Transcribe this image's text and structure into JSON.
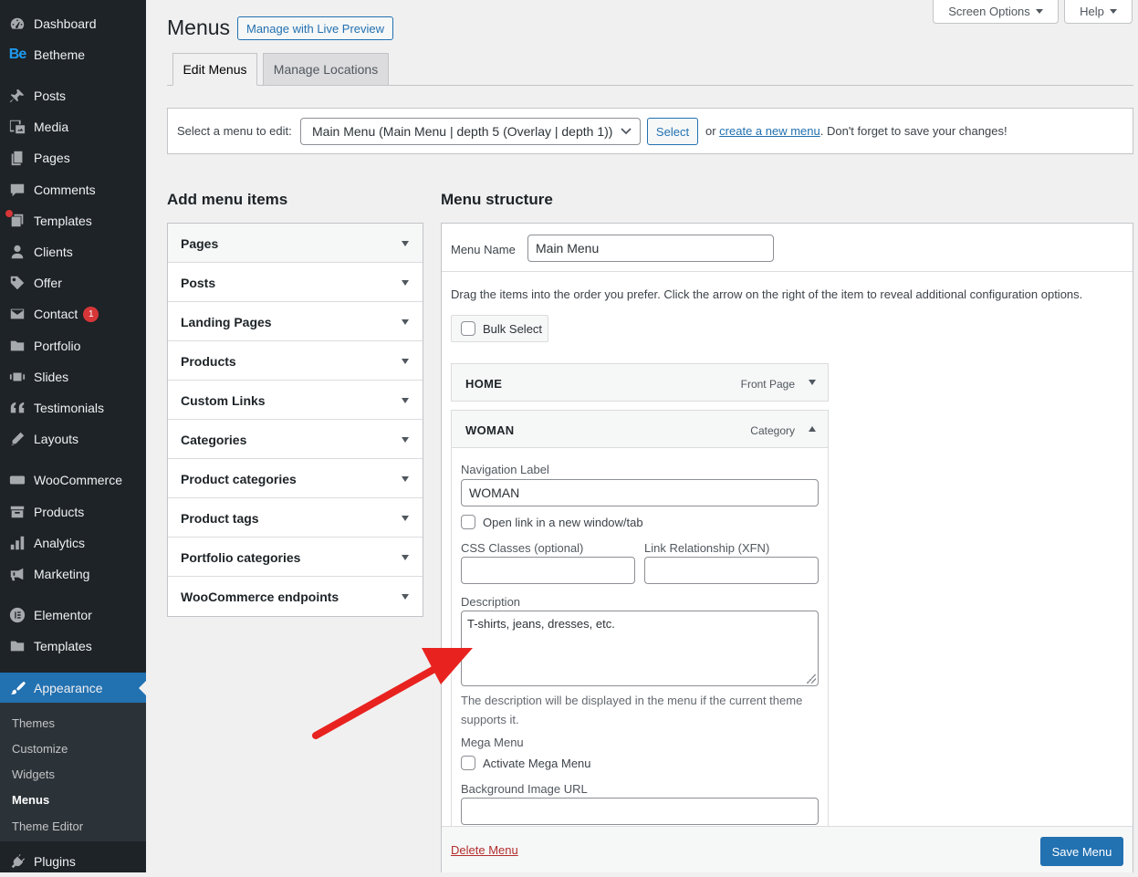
{
  "sidebar": {
    "items": [
      {
        "label": "Dashboard",
        "icon": "dashboard-icon"
      },
      {
        "label": "Betheme",
        "icon": "betheme-logo"
      },
      {
        "label": "Posts",
        "icon": "pushpin-icon"
      },
      {
        "label": "Media",
        "icon": "media-icon"
      },
      {
        "label": "Pages",
        "icon": "pages-icon"
      },
      {
        "label": "Comments",
        "icon": "comment-icon"
      },
      {
        "label": "Templates",
        "icon": "templates-icon"
      },
      {
        "label": "Clients",
        "icon": "person-icon"
      },
      {
        "label": "Offer",
        "icon": "tag-icon"
      },
      {
        "label": "Contact",
        "icon": "mail-icon",
        "badge": "1"
      },
      {
        "label": "Portfolio",
        "icon": "folder-icon"
      },
      {
        "label": "Slides",
        "icon": "slides-icon"
      },
      {
        "label": "Testimonials",
        "icon": "quote-icon"
      },
      {
        "label": "Layouts",
        "icon": "pencil-icon"
      },
      {
        "label": "WooCommerce",
        "icon": "woo-icon"
      },
      {
        "label": "Products",
        "icon": "archive-icon"
      },
      {
        "label": "Analytics",
        "icon": "bar-chart-icon"
      },
      {
        "label": "Marketing",
        "icon": "megaphone-icon"
      },
      {
        "label": "Elementor",
        "icon": "elementor-icon"
      },
      {
        "label": "Templates",
        "icon": "folder-icon"
      },
      {
        "label": "Appearance",
        "icon": "brush-icon"
      },
      {
        "label": "Plugins",
        "icon": "plug-icon"
      }
    ],
    "submenu": [
      "Themes",
      "Customize",
      "Widgets",
      "Menus",
      "Theme Editor"
    ],
    "betheme_logo_text": "Be"
  },
  "topbar": {
    "screen_options": "Screen Options",
    "help": "Help"
  },
  "header": {
    "title": "Menus",
    "live_preview": "Manage with Live Preview",
    "tabs": [
      "Edit Menus",
      "Manage Locations"
    ]
  },
  "select_bar": {
    "label": "Select a menu to edit:",
    "selected": "Main Menu (Main Menu | depth 5 (Overlay | depth 1))",
    "button": "Select",
    "help_prefix": "or ",
    "help_link": "create a new menu",
    "help_suffix": ". Don't forget to save your changes!"
  },
  "add_items": {
    "heading": "Add menu items",
    "sections": [
      "Pages",
      "Posts",
      "Landing Pages",
      "Products",
      "Custom Links",
      "Categories",
      "Product categories",
      "Product tags",
      "Portfolio categories",
      "WooCommerce endpoints"
    ]
  },
  "structure": {
    "heading": "Menu structure",
    "menu_name_label": "Menu Name",
    "menu_name_value": "Main Menu",
    "instructions": "Drag the items into the order you prefer. Click the arrow on the right of the item to reveal additional configuration options.",
    "bulk_select": "Bulk Select",
    "items": [
      {
        "title": "HOME",
        "type": "Front Page"
      },
      {
        "title": "WOMAN",
        "type": "Category"
      }
    ],
    "settings": {
      "nav_label_label": "Navigation Label",
      "nav_label_value": "WOMAN",
      "new_tab_label": "Open link in a new window/tab",
      "css_classes_label": "CSS Classes (optional)",
      "xfn_label": "Link Relationship (XFN)",
      "description_label": "Description",
      "description_value": "T-shirts, jeans, dresses, etc.",
      "description_help": "The description will be displayed in the menu if the current theme supports it.",
      "mega_menu_label": "Mega Menu",
      "activate_mega_label": "Activate Mega Menu",
      "bg_image_label": "Background Image URL"
    },
    "delete_menu": "Delete Menu",
    "save_menu": "Save Menu"
  },
  "colors": {
    "sidebar_bg": "#1d2327",
    "accent": "#2271b1",
    "annotation_arrow": "#e8231f",
    "danger": "#b32d2e"
  }
}
